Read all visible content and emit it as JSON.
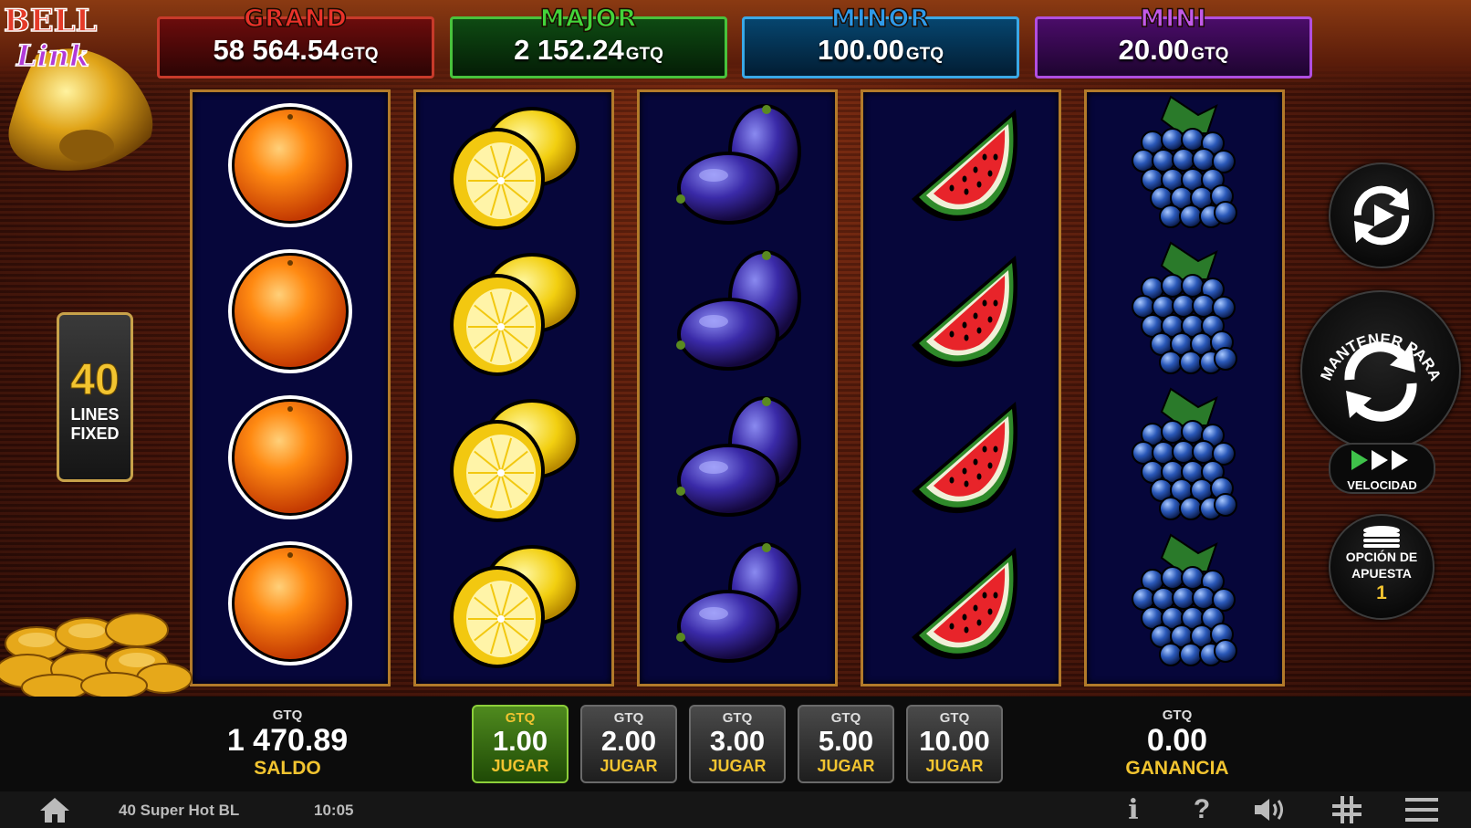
{
  "jackpots": {
    "grand": {
      "title": "GRAND",
      "value": "58 564.54",
      "currency": "GTQ",
      "color": "#e8322a"
    },
    "major": {
      "title": "MAJOR",
      "value": "2 152.24",
      "currency": "GTQ",
      "color": "#43d43a"
    },
    "minor": {
      "title": "MINOR",
      "value": "100.00",
      "currency": "GTQ",
      "color": "#2f9ae8"
    },
    "mini": {
      "title": "MINI",
      "value": "20.00",
      "currency": "GTQ",
      "color": "#c25ae8"
    }
  },
  "logo": {
    "line1": "BELL",
    "line2": "Link"
  },
  "lines": {
    "count": "40",
    "label1": "LINES",
    "label2": "FIXED"
  },
  "reels": [
    [
      "orange",
      "orange",
      "orange",
      "orange"
    ],
    [
      "lemon",
      "lemon",
      "lemon",
      "lemon"
    ],
    [
      "plum",
      "plum",
      "plum",
      "plum"
    ],
    [
      "watermelon",
      "watermelon",
      "watermelon",
      "watermelon"
    ],
    [
      "grapes",
      "grapes",
      "grapes",
      "grapes"
    ]
  ],
  "controls": {
    "autoplay_icon": "autoplay-icon",
    "spin_text": "MANTENER PARA JUEGO RÁPIDO",
    "speed_label": "VELOCIDAD",
    "bet_option_label1": "OPCIÓN DE",
    "bet_option_label2": "APUESTA",
    "bet_option_value": "1"
  },
  "balance": {
    "currency": "GTQ",
    "value": "1 470.89",
    "label": "SALDO"
  },
  "win": {
    "currency": "GTQ",
    "value": "0.00",
    "label": "GANANCIA"
  },
  "bets": [
    {
      "currency": "GTQ",
      "value": "1.00",
      "label": "JUGAR",
      "active": true
    },
    {
      "currency": "GTQ",
      "value": "2.00",
      "label": "JUGAR",
      "active": false
    },
    {
      "currency": "GTQ",
      "value": "3.00",
      "label": "JUGAR",
      "active": false
    },
    {
      "currency": "GTQ",
      "value": "5.00",
      "label": "JUGAR",
      "active": false
    },
    {
      "currency": "GTQ",
      "value": "10.00",
      "label": "JUGAR",
      "active": false
    }
  ],
  "statusbar": {
    "game_name": "40 Super Hot BL",
    "time": "10:05",
    "info_glyph": "i",
    "help_glyph": "?"
  }
}
